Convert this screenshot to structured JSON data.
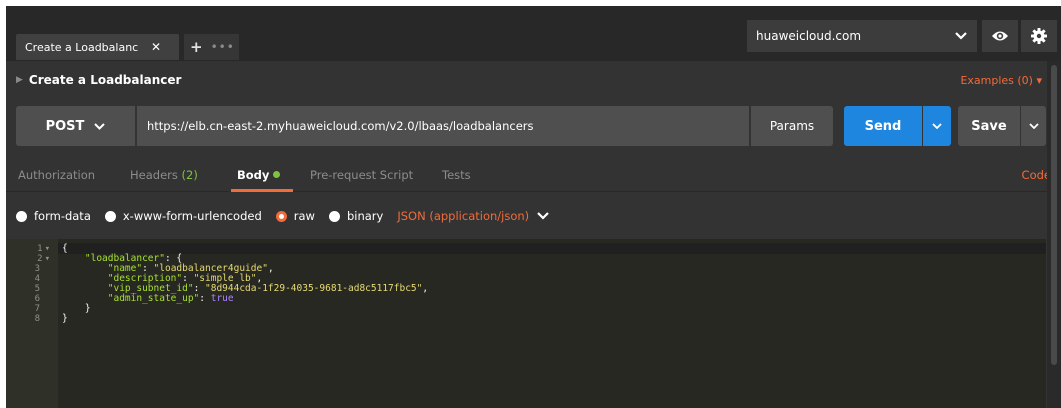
{
  "tabs": {
    "active_tab_label": "Create a Loadbalanc",
    "close_symbol": "✕",
    "new_tab_symbol": "+",
    "more_symbol": "•••"
  },
  "environment": {
    "selected": "huaweicloud.com"
  },
  "request": {
    "name": "Create a Loadbalancer",
    "examples_label": "Examples (0) ▾",
    "method": "POST",
    "url": "https://elb.cn-east-2.myhuaweicloud.com/v2.0/lbaas/loadbalancers",
    "params_label": "Params",
    "send_label": "Send",
    "save_label": "Save"
  },
  "subtabs": {
    "authorization": "Authorization",
    "headers": "Headers",
    "headers_count": "(2)",
    "body": "Body",
    "prerequest": "Pre-request Script",
    "tests": "Tests",
    "code": "Code"
  },
  "body_modes": {
    "form_data": "form-data",
    "urlencoded": "x-www-form-urlencoded",
    "raw": "raw",
    "binary": "binary",
    "content_type": "JSON (application/json)",
    "selected": "raw"
  },
  "editor": {
    "line_numbers": [
      "1",
      "2",
      "3",
      "4",
      "5",
      "6",
      "7",
      "8"
    ],
    "lines": [
      {
        "open": "{"
      },
      {
        "key": "\"loadbalancer\"",
        "rest": ": {"
      },
      {
        "key": "\"name\"",
        "value": "\"loadbalancer4guide\""
      },
      {
        "key": "\"description\"",
        "value": "\"simple lb\""
      },
      {
        "key": "\"vip_subnet_id\"",
        "value": "\"8d944cda-1f29-4035-9681-ad8c5117fbc5\""
      },
      {
        "key": "\"admin_state_up\"",
        "value": "true"
      },
      {
        "close": "}"
      },
      {
        "close": "}"
      }
    ]
  },
  "colors": {
    "accent": "#f26b3a",
    "send_blue": "#1f86e0",
    "status_green": "#7fc242"
  }
}
